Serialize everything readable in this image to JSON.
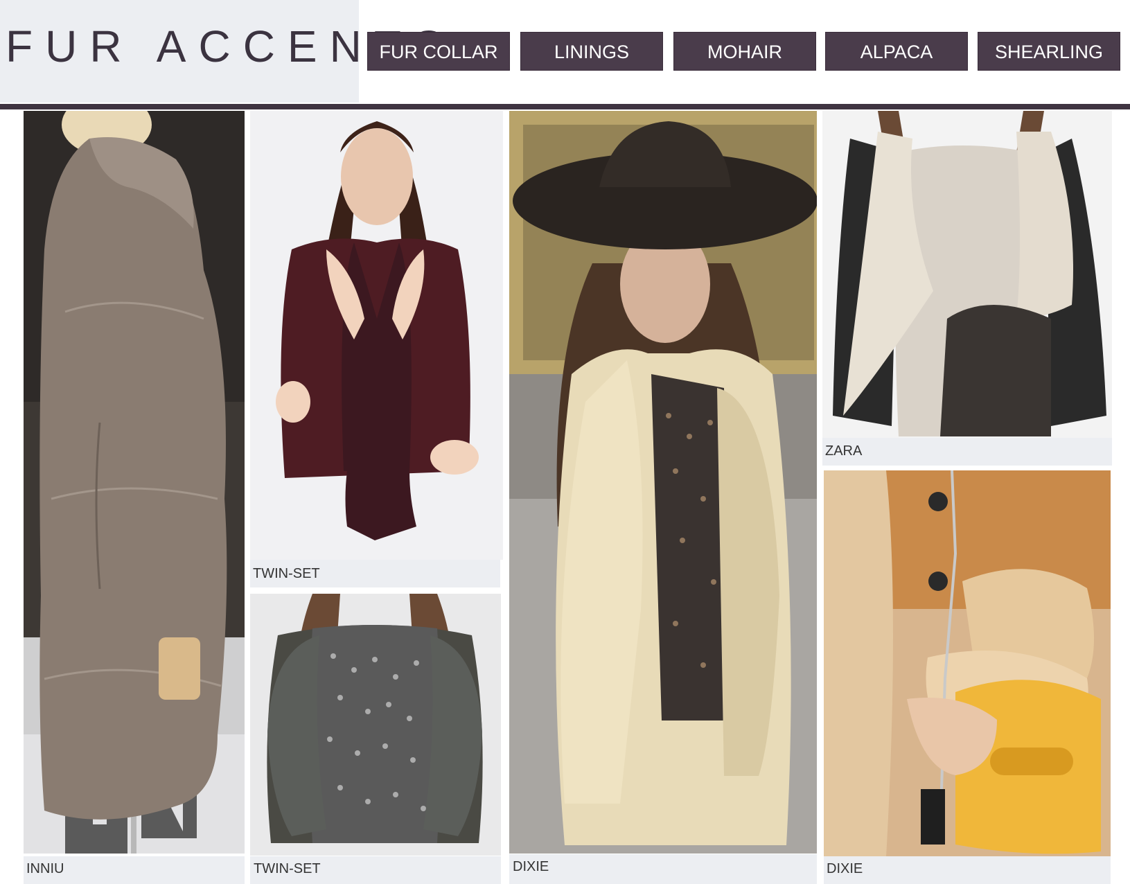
{
  "header": {
    "title": "FUR ACCENTS",
    "tags": [
      "FUR COLLAR",
      "LININGS",
      "MOHAIR",
      "ALPACA",
      "SHEARLING"
    ]
  },
  "panels": [
    {
      "caption": "INNIU"
    },
    {
      "caption": "TWIN-SET"
    },
    {
      "caption": "TWIN-SET"
    },
    {
      "caption": "DIXIE"
    },
    {
      "caption": "ZARA"
    },
    {
      "caption": "DIXIE"
    }
  ],
  "colors": {
    "accent": "#4a3c4b",
    "rule": "#3f3441",
    "title_bg": "#eceef2"
  }
}
